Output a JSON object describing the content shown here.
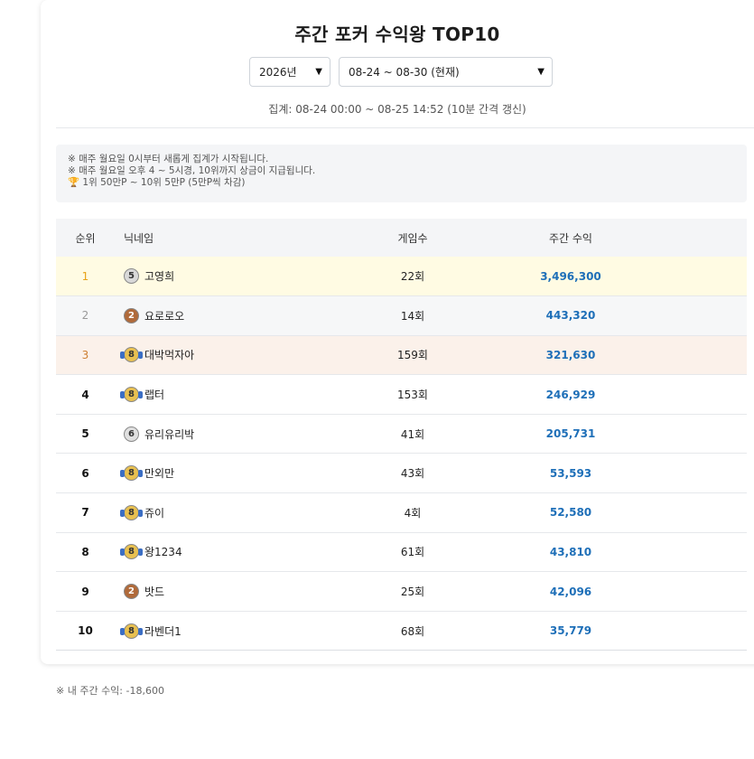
{
  "title": "주간 포커 수익왕 TOP10",
  "year_select": {
    "value": "2026년"
  },
  "week_select": {
    "value": "08-24 ~ 08-30 (현재)"
  },
  "aggregation": "집계: 08-24 00:00 ~ 08-25 14:52 (10분 간격 갱신)",
  "notice": {
    "line1": "※ 매주 월요일 0시부터 새롭게 집계가 시작됩니다.",
    "line2": "※ 매주 월요일 오후 4 ~ 5시경, 10위까지 상금이 지급됩니다.",
    "line3_icon": "trophy-icon",
    "line3": "1위 50만P ~ 10위 5만P (5만P씩 차감)"
  },
  "table": {
    "headers": {
      "rank": "순위",
      "nickname": "닉네임",
      "games": "게임수",
      "profit": "주간 수익"
    },
    "rows": [
      {
        "rank": "1",
        "level": "5",
        "nickname": "고영희",
        "games": "22회",
        "profit": "3,496,300",
        "row_bg": "#fffbe3",
        "rank_color": "#e8a317",
        "badge_bg": "#d9d9d9",
        "badge_fg": "#333",
        "badge_icon": "level-badge-icon",
        "wing": false
      },
      {
        "rank": "2",
        "level": "2",
        "nickname": "요로로오",
        "games": "14회",
        "profit": "443,320",
        "row_bg": "#f6f7f8",
        "rank_color": "#999999",
        "badge_bg": "#b06a3a",
        "badge_fg": "#fff",
        "badge_icon": "level-badge-icon",
        "wing": false
      },
      {
        "rank": "3",
        "level": "8",
        "nickname": "대박먹자아",
        "games": "159회",
        "profit": "321,630",
        "row_bg": "#fbf1ea",
        "rank_color": "#cd7f32",
        "badge_bg": "#e8c050",
        "badge_fg": "#333",
        "badge_icon": "level-badge-icon",
        "wing": true
      },
      {
        "rank": "4",
        "level": "8",
        "nickname": "랩터",
        "games": "153회",
        "profit": "246,929",
        "row_bg": "#ffffff",
        "rank_color": "#111111",
        "badge_bg": "#e8c050",
        "badge_fg": "#333",
        "badge_icon": "level-badge-icon",
        "wing": true
      },
      {
        "rank": "5",
        "level": "6",
        "nickname": "유리유리박",
        "games": "41회",
        "profit": "205,731",
        "row_bg": "#ffffff",
        "rank_color": "#111111",
        "badge_bg": "#e0e0e0",
        "badge_fg": "#333",
        "badge_icon": "level-badge-icon",
        "wing": false
      },
      {
        "rank": "6",
        "level": "8",
        "nickname": "만외만",
        "games": "43회",
        "profit": "53,593",
        "row_bg": "#ffffff",
        "rank_color": "#111111",
        "badge_bg": "#e8c050",
        "badge_fg": "#333",
        "badge_icon": "level-badge-icon",
        "wing": true
      },
      {
        "rank": "7",
        "level": "8",
        "nickname": "쥬이",
        "games": "4회",
        "profit": "52,580",
        "row_bg": "#ffffff",
        "rank_color": "#111111",
        "badge_bg": "#e8c050",
        "badge_fg": "#333",
        "badge_icon": "level-badge-icon",
        "wing": true
      },
      {
        "rank": "8",
        "level": "8",
        "nickname": "왕1234",
        "games": "61회",
        "profit": "43,810",
        "row_bg": "#ffffff",
        "rank_color": "#111111",
        "badge_bg": "#e8c050",
        "badge_fg": "#333",
        "badge_icon": "level-badge-icon",
        "wing": true
      },
      {
        "rank": "9",
        "level": "2",
        "nickname": "밧드",
        "games": "25회",
        "profit": "42,096",
        "row_bg": "#ffffff",
        "rank_color": "#111111",
        "badge_bg": "#b06a3a",
        "badge_fg": "#fff",
        "badge_icon": "level-badge-icon",
        "wing": false
      },
      {
        "rank": "10",
        "level": "8",
        "nickname": "라벤더1",
        "games": "68회",
        "profit": "35,779",
        "row_bg": "#ffffff",
        "rank_color": "#111111",
        "badge_bg": "#e8c050",
        "badge_fg": "#333",
        "badge_icon": "level-badge-icon",
        "wing": true
      }
    ]
  },
  "my_profit": "※ 내 주간 수익: -18,600",
  "colors": {
    "profit": "#1e6fb8",
    "notice_bg": "#f4f5f7"
  }
}
